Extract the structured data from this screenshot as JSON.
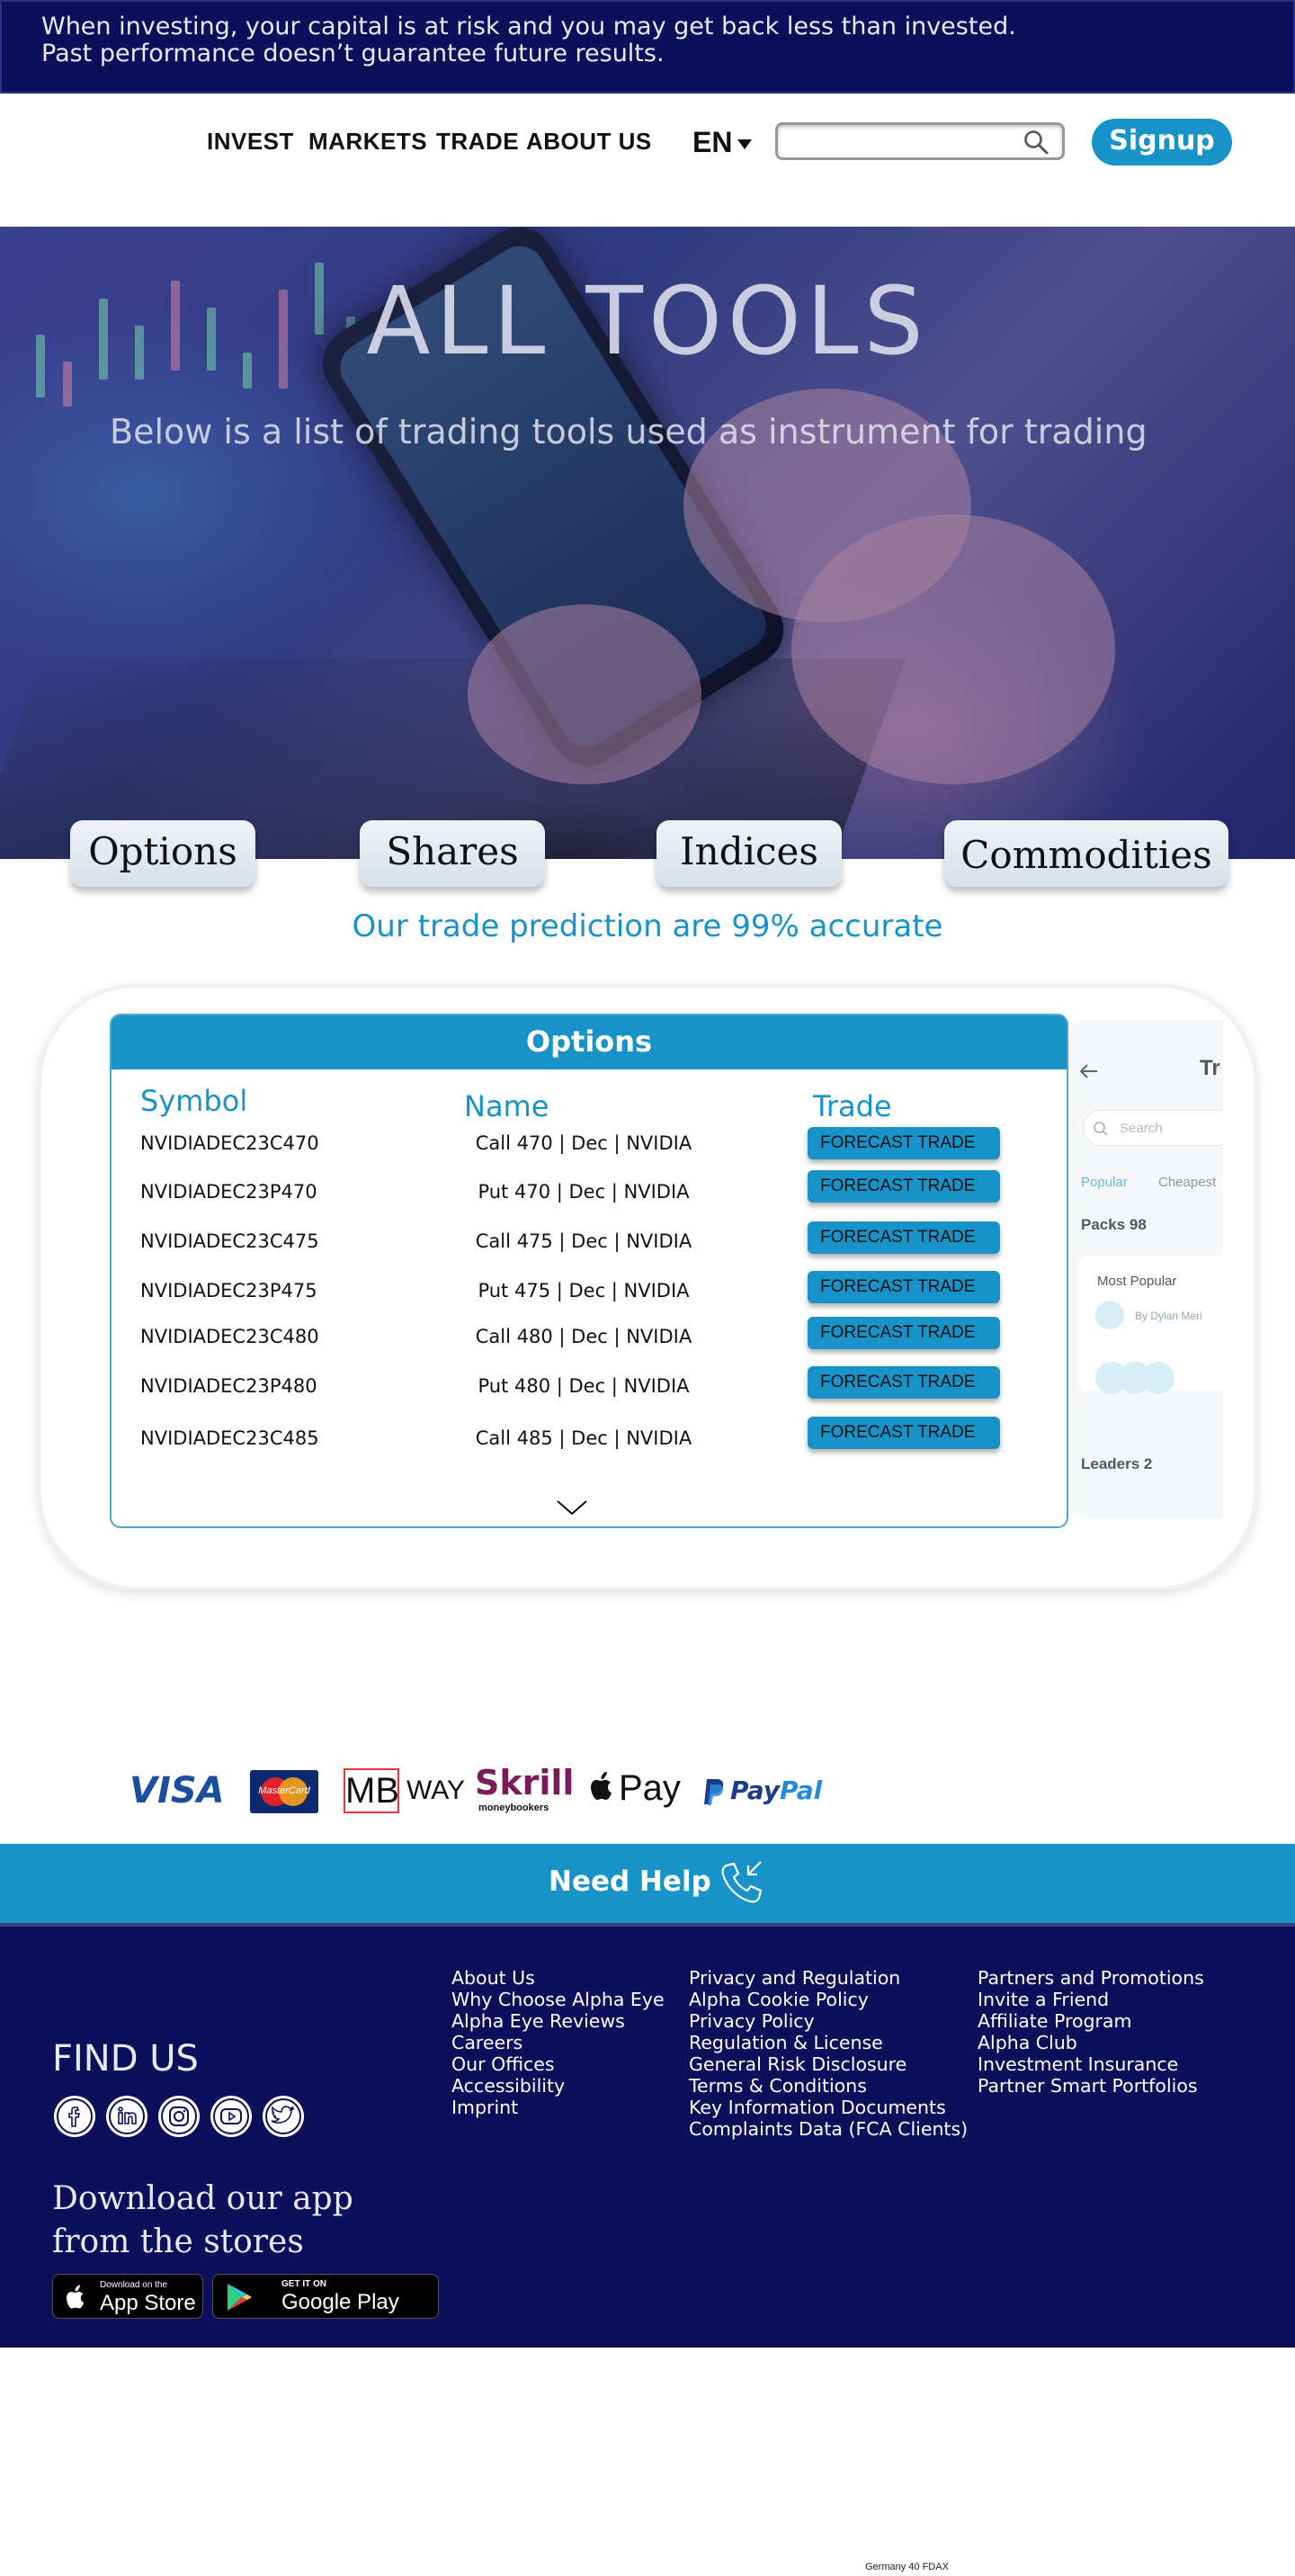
{
  "risk_banner": {
    "line1": "When investing, your capital is at risk and you may get back less than invested.",
    "line2": "Past performance doesn’t guarantee future results."
  },
  "nav": {
    "items": [
      {
        "label": "INVEST"
      },
      {
        "label": "MARKETS"
      },
      {
        "label": "TRADE"
      },
      {
        "label": "ABOUT US"
      }
    ],
    "language": "EN",
    "search_value": "",
    "signup_label": "Signup"
  },
  "hero": {
    "title": "ALL TOOLS",
    "subtitle": "Below is a list of trading tools used as instrument for trading"
  },
  "categories": [
    "Options",
    "Shares",
    "Indices",
    "Commodities"
  ],
  "accuracy_text": "Our trade prediction are 99% accurate",
  "options_table": {
    "title": "Options",
    "columns": [
      "Symbol",
      "Name",
      "Trade"
    ],
    "rows": [
      {
        "symbol": "NVIDIADEC23C470",
        "name": "Call 470 | Dec | NVIDIA",
        "action": "FORECAST TRADE"
      },
      {
        "symbol": "NVIDIADEC23P470",
        "name": "Put 470 | Dec | NVIDIA",
        "action": "FORECAST TRADE"
      },
      {
        "symbol": "NVIDIADEC23C475",
        "name": "Call 475 | Dec | NVIDIA",
        "action": "FORECAST TRADE"
      },
      {
        "symbol": "NVIDIADEC23P475",
        "name": "Put 475 | Dec | NVIDIA",
        "action": "FORECAST TRADE"
      },
      {
        "symbol": "NVIDIADEC23C480",
        "name": "Call 480 | Dec | NVIDIA",
        "action": "FORECAST TRADE"
      },
      {
        "symbol": "NVIDIADEC23P480",
        "name": "Put 480 | Dec | NVIDIA",
        "action": "FORECAST TRADE"
      },
      {
        "symbol": "NVIDIADEC23C485",
        "name": "Call 485 | Dec | NVIDIA",
        "action": "FORECAST TRADE"
      }
    ]
  },
  "app_preview": {
    "title": "Tr",
    "search_placeholder": "Search",
    "tabs": [
      "Popular",
      "Cheapest"
    ],
    "packs": "Packs 98",
    "card_title": "Most Popular",
    "card_author": "By Dylan Meri",
    "leaders": "Leaders 2"
  },
  "payments": {
    "visa": "VISA",
    "mastercard": "MasterCard",
    "mbway_mb": "MB",
    "mbway_way": "WAY",
    "skrill": "Skrill",
    "skrill_sub": "moneybookers",
    "applepay": "Pay",
    "paypal_pay": "Pay",
    "paypal_pal": "Pal"
  },
  "help": {
    "label": "Need Help"
  },
  "footer": {
    "col1": [
      "About Us",
      "Why Choose Alpha Eye",
      "Alpha Eye Reviews",
      "Careers",
      "Our Offices",
      "Accessibility",
      "Imprint"
    ],
    "col2": [
      "Privacy and Regulation",
      "Alpha Cookie Policy",
      "Privacy Policy",
      "Regulation & License",
      "General Risk Disclosure",
      "Terms & Conditions",
      "Key Information Documents",
      "Complaints Data (FCA Clients)"
    ],
    "col3": [
      "Partners and Promotions",
      "Invite a Friend",
      "Affiliate Program",
      "Alpha Club",
      "Investment Insurance",
      "Partner Smart Portfolios"
    ],
    "find_us": "FIND US",
    "download_line1": "Download our app",
    "download_line2": "from the stores",
    "appstore_small": "Download on the",
    "appstore_big": "App Store",
    "googleplay_small": "GET IT ON",
    "googleplay_big": "Google Play"
  },
  "bottom_note": "Germany 40 FDAX",
  "colors": {
    "navy": "#0c0f5a",
    "accent_blue": "#1793ca"
  }
}
